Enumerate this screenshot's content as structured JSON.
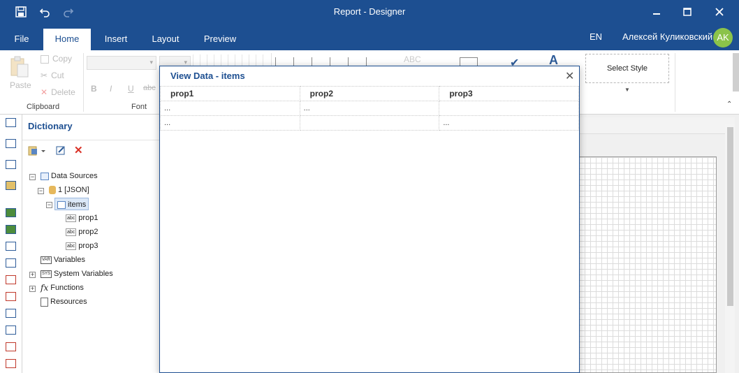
{
  "window": {
    "title": "Report - Designer"
  },
  "menu": {
    "tabs": [
      {
        "label": "File"
      },
      {
        "label": "Home"
      },
      {
        "label": "Insert"
      },
      {
        "label": "Layout"
      },
      {
        "label": "Preview"
      }
    ],
    "lang": "EN",
    "user": "Алексей Куликовский",
    "avatar": "AK"
  },
  "ribbon": {
    "clipboard": {
      "paste": "Paste",
      "copy": "Copy",
      "cut": "Cut",
      "delete": "Delete",
      "label": "Clipboard"
    },
    "font": {
      "label": "Font",
      "bold": "B",
      "italic": "I",
      "underline": "U",
      "strike": "abc",
      "sample": "ABC"
    },
    "select_style": "Select Style"
  },
  "dictionary": {
    "title": "Dictionary",
    "tree": {
      "data_sources": "Data Sources",
      "source": "1 [JSON]",
      "items": "items",
      "props": [
        "prop1",
        "prop2",
        "prop3"
      ],
      "variables": "Variables",
      "system_variables": "System Variables",
      "functions": "Functions",
      "resources": "Resources"
    }
  },
  "dialog": {
    "title": "View Data - items",
    "close": "✕",
    "columns": [
      "prop1",
      "prop2",
      "prop3"
    ],
    "rows": [
      [
        "...",
        "...",
        ""
      ],
      [
        "...",
        "",
        "..."
      ]
    ]
  },
  "colors": {
    "brand": "#1d4f91",
    "avatar": "#8bc34a"
  }
}
